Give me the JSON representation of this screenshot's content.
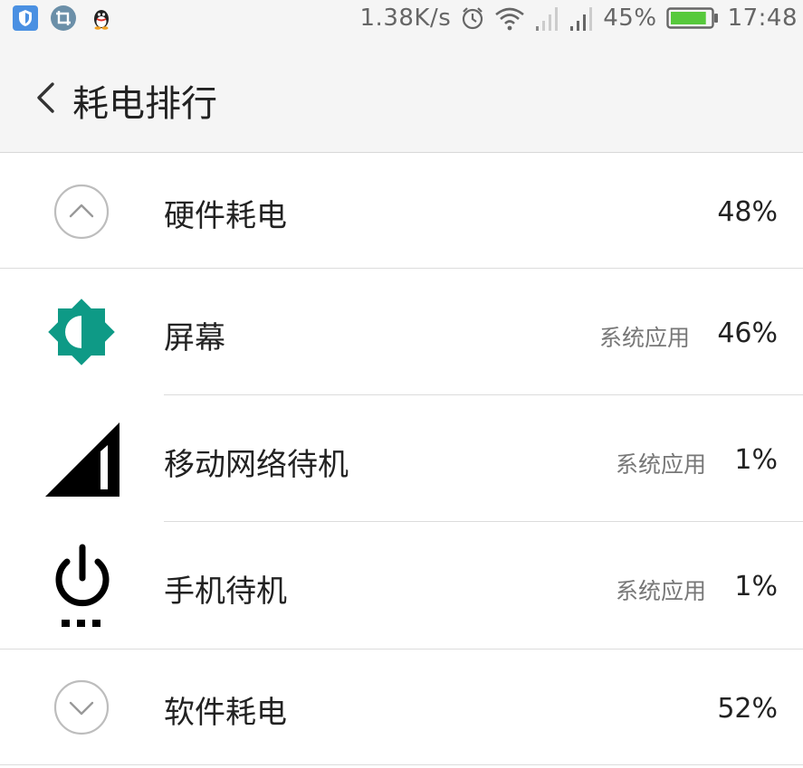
{
  "status_bar": {
    "net_speed": "1.38K/s",
    "battery_percent": "45%",
    "battery_level": 0.45,
    "time": "17:48",
    "notification_icons": [
      "shield-icon",
      "screenshot-icon",
      "qq-penguin-icon"
    ],
    "system_icons": [
      "alarm-icon",
      "wifi-icon",
      "signal-icon",
      "signal-icon",
      "battery-icon"
    ]
  },
  "header": {
    "title": "耗电排行"
  },
  "sections": {
    "hardware": {
      "label": "硬件耗电",
      "percent": "48%",
      "toggle": "collapse"
    },
    "software": {
      "label": "软件耗电",
      "percent": "52%",
      "toggle": "expand"
    }
  },
  "items": [
    {
      "icon": "screen-brightness-icon",
      "label": "屏幕",
      "category": "系统应用",
      "percent": "46%",
      "icon_color": "#0e9a86"
    },
    {
      "icon": "cell-signal-icon",
      "label": "移动网络待机",
      "category": "系统应用",
      "percent": "1%"
    },
    {
      "icon": "power-standby-icon",
      "label": "手机待机",
      "category": "系统应用",
      "percent": "1%"
    }
  ],
  "colors": {
    "accent_teal": "#0e9a86",
    "battery_green": "#57c93c",
    "background": "#f5f5f5"
  }
}
